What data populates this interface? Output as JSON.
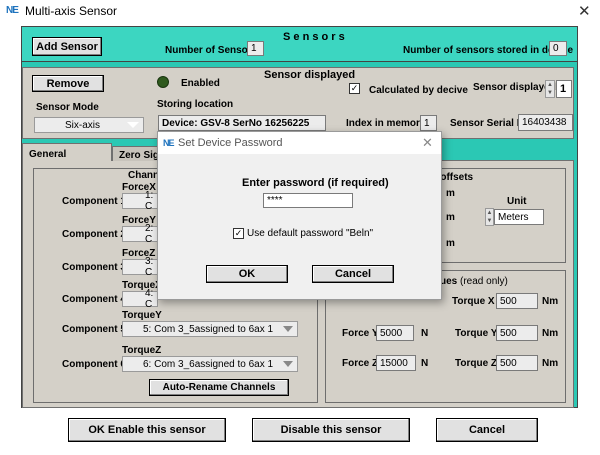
{
  "window": {
    "title": "Multi-axis Sensor",
    "logo": "NE"
  },
  "top": {
    "add_sensor": "Add Sensor",
    "sensors_heading": "S e n s o r s",
    "num_sensors_label": "Number of Sensors",
    "num_sensors_value": "1",
    "stored_label": "Number of sensors stored in device",
    "stored_value": "0"
  },
  "sensor": {
    "remove": "Remove",
    "enabled_label": "Enabled",
    "displayed_heading": "Sensor displayed",
    "calculated_label": "Calculated by decive",
    "calculated_checked": true,
    "sensor_displayed_label": "Sensor displayed",
    "sensor_displayed_value": "1",
    "mode_label": "Sensor Mode",
    "mode_value": "Six-axis",
    "storing_label": "Storing location",
    "storing_value": "Device: GSV-8 SerNo 16256225",
    "index_label": "Index in memory",
    "index_value": "1",
    "serial_label": "Sensor Serial No",
    "serial_value": "16403438"
  },
  "tabs": [
    {
      "label": "General"
    },
    {
      "label": "Zero Sign"
    }
  ],
  "channels": {
    "heading": "Channe",
    "rows": [
      {
        "label": "Component 1:",
        "axis": "ForceX",
        "value": "1: C"
      },
      {
        "label": "Component 2:",
        "axis": "ForceY",
        "value": "2: C"
      },
      {
        "label": "Component 3:",
        "axis": "ForceZ",
        "value": "3: C"
      },
      {
        "label": "Component 4:",
        "axis": "TorqueX",
        "value": "4: C"
      },
      {
        "label": "Component 5:",
        "axis": "TorqueY",
        "value": "5: Com 3_5assigned to 6ax 1"
      },
      {
        "label": "Component 6:",
        "axis": "TorqueZ",
        "value": "6: Com 3_6assigned to 6ax 1"
      }
    ],
    "auto_rename": "Auto-Rename Channels"
  },
  "offsets": {
    "heading": "e offsets",
    "m1": "m",
    "m2": "m",
    "m3": "m",
    "unit_label": "Unit",
    "unit_value": "Meters"
  },
  "values": {
    "heading": "ues",
    "read_only": "(read only)",
    "rows": [
      {
        "f_label": "Force Y",
        "f_value": "5000",
        "f_unit": "N",
        "t_label": "Torque Y",
        "t_value": "500",
        "t_unit": "Nm"
      },
      {
        "f_label": "Force Z",
        "f_value": "15000",
        "f_unit": "N",
        "t_label": "Torque Z",
        "t_value": "500",
        "t_unit": "Nm"
      }
    ],
    "tx_label": "Torque X",
    "tx_value": "500",
    "tx_unit": "Nm"
  },
  "bottom": {
    "ok_enable": "OK Enable this sensor",
    "disable": "Disable this sensor",
    "cancel": "Cancel"
  },
  "dialog": {
    "logo": "NE",
    "title": "Set Device Password",
    "prompt": "Enter password (if required)",
    "password": "****",
    "checkbox_label": "Use default password \"Beln\"",
    "checkbox_checked": true,
    "ok": "OK",
    "cancel": "Cancel"
  },
  "colors": {
    "teal": "#2bc8b4",
    "header": "#3cd6c1",
    "panel": "#d4d0c8",
    "led": "#2f5a1e"
  }
}
